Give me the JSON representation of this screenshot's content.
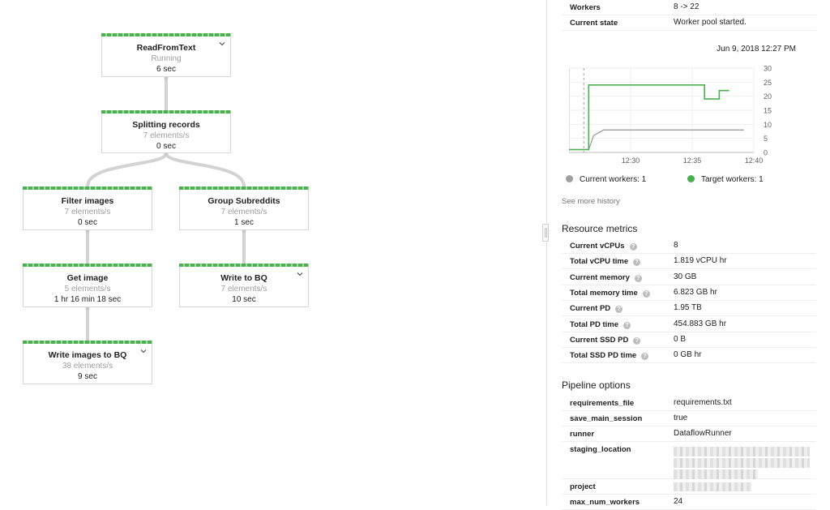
{
  "graph": {
    "nodes": [
      {
        "id": "read",
        "title": "ReadFromText",
        "sub": "Running",
        "time": "6 sec",
        "expandable": true
      },
      {
        "id": "split",
        "title": "Splitting records",
        "sub": "7 elements/s",
        "time": "0 sec",
        "expandable": false
      },
      {
        "id": "filter",
        "title": "Filter images",
        "sub": "7 elements/s",
        "time": "0 sec",
        "expandable": false
      },
      {
        "id": "group",
        "title": "Group Subreddits",
        "sub": "7 elements/s",
        "time": "1 sec",
        "expandable": false
      },
      {
        "id": "getimg",
        "title": "Get image",
        "sub": "5 elements/s",
        "time": "1 hr 16 min 18 sec",
        "expandable": false
      },
      {
        "id": "writebq",
        "title": "Write to BQ",
        "sub": "7 elements/s",
        "time": "10 sec",
        "expandable": true
      },
      {
        "id": "writeimg",
        "title": "Write images to BQ",
        "sub": "38 elements/s",
        "time": "9 sec",
        "expandable": true
      }
    ]
  },
  "autoscaling": {
    "rows": [
      {
        "key": "Workers",
        "value": "8 -> 22"
      },
      {
        "key": "Current state",
        "value": "Worker pool started."
      }
    ],
    "chart_date": "Jun 9, 2018 12:27 PM",
    "see_more": "See more history"
  },
  "chart_data": {
    "type": "line",
    "x_ticks": [
      "12:30",
      "12:35",
      "12:40"
    ],
    "y_ticks": [
      0,
      5,
      10,
      15,
      20,
      25,
      30
    ],
    "ylim": [
      0,
      30
    ],
    "xlim": [
      "12:25",
      "12:40"
    ],
    "grid": true,
    "series": [
      {
        "name": "Current workers: 1",
        "color": "#9e9e9e",
        "values": [
          [
            0,
            1
          ],
          [
            1.2,
            1
          ],
          [
            1.6,
            1
          ],
          [
            2.0,
            6
          ],
          [
            2.4,
            7
          ],
          [
            2.8,
            8
          ],
          [
            5,
            8
          ],
          [
            10,
            8
          ],
          [
            14.2,
            8
          ]
        ]
      },
      {
        "name": "Target workers: 1",
        "color": "#4caf50",
        "values": [
          [
            0,
            1
          ],
          [
            1.6,
            1
          ],
          [
            1.6,
            24
          ],
          [
            5,
            24
          ],
          [
            10,
            24
          ],
          [
            11,
            24
          ],
          [
            11,
            19
          ],
          [
            12.2,
            19
          ],
          [
            12.2,
            22
          ],
          [
            13,
            22
          ]
        ]
      }
    ],
    "legend": [
      {
        "label": "Current workers: 1",
        "color": "#9e9e9e"
      },
      {
        "label": "Target workers: 1",
        "color": "#4caf50"
      }
    ]
  },
  "resource_metrics": {
    "title": "Resource metrics",
    "rows": [
      {
        "key": "Current vCPUs",
        "value": "8"
      },
      {
        "key": "Total vCPU time",
        "value": "1.819 vCPU hr"
      },
      {
        "key": "Current memory",
        "value": "30 GB"
      },
      {
        "key": "Total memory time",
        "value": "6.823 GB hr"
      },
      {
        "key": "Current PD",
        "value": "1.95 TB"
      },
      {
        "key": "Total PD time",
        "value": "454.883 GB hr"
      },
      {
        "key": "Current SSD PD",
        "value": "0 B"
      },
      {
        "key": "Total SSD PD time",
        "value": "0 GB hr"
      }
    ],
    "help_glyph": "?"
  },
  "pipeline_options": {
    "title": "Pipeline options",
    "rows": [
      {
        "key": "requirements_file",
        "value": "requirements.txt"
      },
      {
        "key": "save_main_session",
        "value": "true"
      },
      {
        "key": "runner",
        "value": "DataflowRunner"
      },
      {
        "key": "staging_location",
        "value": ""
      },
      {
        "key": "project",
        "value": ""
      },
      {
        "key": "max_num_workers",
        "value": "24"
      }
    ]
  },
  "icons": {
    "chevron": "chevron-down-icon",
    "help": "help-icon"
  },
  "colors": {
    "accent": "#4caf50",
    "current": "#9e9e9e"
  }
}
